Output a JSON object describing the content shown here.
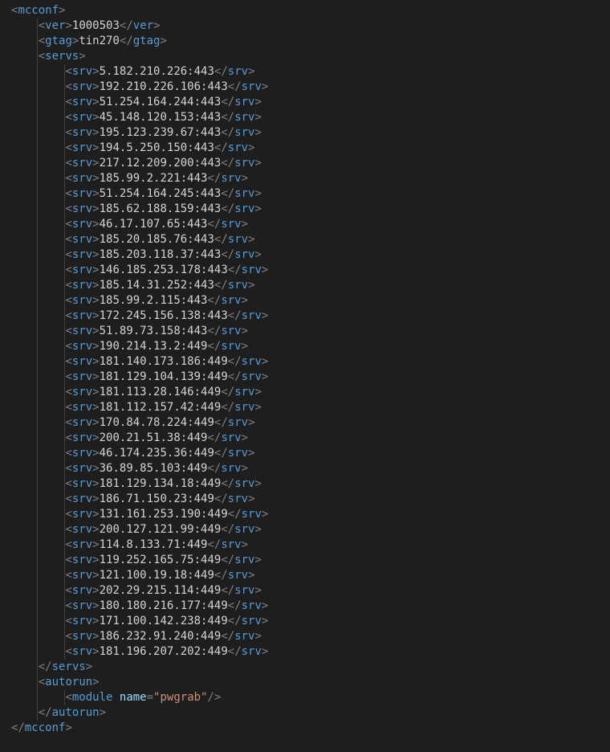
{
  "root": "mcconf",
  "ver_tag": "ver",
  "ver_value": "1000503",
  "gtag_tag": "gtag",
  "gtag_value": "tin270",
  "servs_tag": "servs",
  "srv_tag": "srv",
  "servers": [
    "5.182.210.226:443",
    "192.210.226.106:443",
    "51.254.164.244:443",
    "45.148.120.153:443",
    "195.123.239.67:443",
    "194.5.250.150:443",
    "217.12.209.200:443",
    "185.99.2.221:443",
    "51.254.164.245:443",
    "185.62.188.159:443",
    "46.17.107.65:443",
    "185.20.185.76:443",
    "185.203.118.37:443",
    "146.185.253.178:443",
    "185.14.31.252:443",
    "185.99.2.115:443",
    "172.245.156.138:443",
    "51.89.73.158:443",
    "190.214.13.2:449",
    "181.140.173.186:449",
    "181.129.104.139:449",
    "181.113.28.146:449",
    "181.112.157.42:449",
    "170.84.78.224:449",
    "200.21.51.38:449",
    "46.174.235.36:449",
    "36.89.85.103:449",
    "181.129.134.18:449",
    "186.71.150.23:449",
    "131.161.253.190:449",
    "200.127.121.99:449",
    "114.8.133.71:449",
    "119.252.165.75:449",
    "121.100.19.18:449",
    "202.29.215.114:449",
    "180.180.216.177:449",
    "171.100.142.238:449",
    "186.232.91.240:449",
    "181.196.207.202:449"
  ],
  "autorun_tag": "autorun",
  "module_tag": "module",
  "module_attr": "name",
  "module_value": "pwgrab"
}
